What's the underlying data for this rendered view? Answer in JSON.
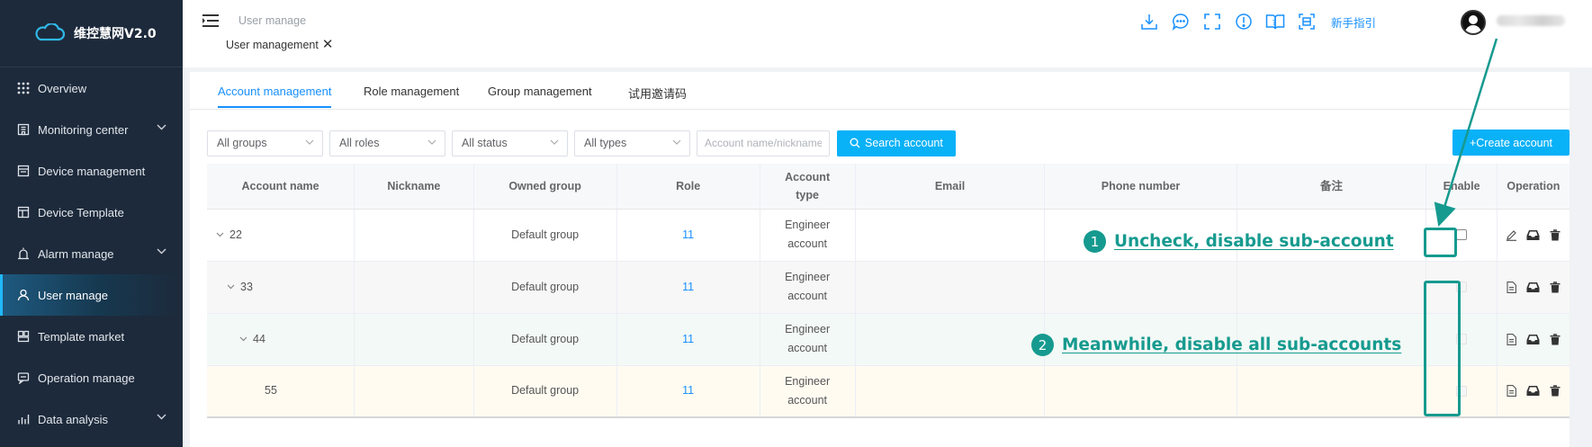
{
  "app": {
    "title": "维控慧网V2.0"
  },
  "sidebar": {
    "items": [
      {
        "label": "Overview",
        "icon": "grid-icon",
        "expandable": false,
        "active": false
      },
      {
        "label": "Monitoring center",
        "icon": "building-icon",
        "expandable": true,
        "active": false
      },
      {
        "label": "Device management",
        "icon": "device-icon",
        "expandable": false,
        "active": false
      },
      {
        "label": "Device Template",
        "icon": "template-icon",
        "expandable": false,
        "active": false
      },
      {
        "label": "Alarm manage",
        "icon": "alarm-icon",
        "expandable": true,
        "active": false
      },
      {
        "label": "User manage",
        "icon": "user-icon",
        "expandable": false,
        "active": true
      },
      {
        "label": "Template market",
        "icon": "market-icon",
        "expandable": false,
        "active": false
      },
      {
        "label": "Operation manage",
        "icon": "operation-icon",
        "expandable": false,
        "active": false
      },
      {
        "label": "Data analysis",
        "icon": "chart-icon",
        "expandable": true,
        "active": false
      }
    ]
  },
  "header": {
    "breadcrumb": "User manage",
    "open_tab": "User management",
    "guide_label": "新手指引",
    "icons": [
      "download-icon",
      "chat-icon",
      "fullscreen-icon",
      "info-icon",
      "help-book-icon",
      "scan-icon"
    ]
  },
  "tabs": [
    {
      "label": "Account management",
      "active": true
    },
    {
      "label": "Role management",
      "active": false
    },
    {
      "label": "Group management",
      "active": false
    },
    {
      "label": "试用邀请码",
      "active": false
    }
  ],
  "filters": {
    "group": "All groups",
    "role": "All roles",
    "status": "All status",
    "type": "All types",
    "search_placeholder": "Account name/nickname",
    "search_button": "Search account",
    "create_button": "+Create account"
  },
  "table": {
    "columns": {
      "account_name": "Account name",
      "nickname": "Nickname",
      "owned_group": "Owned group",
      "role": "Role",
      "account_type_1": "Account",
      "account_type_2": "type",
      "email": "Email",
      "phone": "Phone number",
      "remark": "备注",
      "enable": "Enable",
      "operation": "Operation"
    },
    "rows": [
      {
        "name": "22",
        "nickname": "",
        "group": "Default group",
        "role": "11",
        "type1": "Engineer",
        "type2": "account",
        "email": "",
        "phone": "",
        "remark": "",
        "enabled": false,
        "level": 0
      },
      {
        "name": "33",
        "nickname": "",
        "group": "Default group",
        "role": "11",
        "type1": "Engineer",
        "type2": "account",
        "email": "",
        "phone": "",
        "remark": "",
        "enabled": false,
        "level": 1
      },
      {
        "name": "44",
        "nickname": "",
        "group": "Default group",
        "role": "11",
        "type1": "Engineer",
        "type2": "account",
        "email": "",
        "phone": "",
        "remark": "",
        "enabled": false,
        "level": 2
      },
      {
        "name": "55",
        "nickname": "",
        "group": "Default group",
        "role": "11",
        "type1": "Engineer",
        "type2": "account",
        "email": "",
        "phone": "",
        "remark": "",
        "enabled": false,
        "level": 3
      }
    ]
  },
  "annotations": [
    {
      "number": "1",
      "text": "Uncheck, disable sub-account"
    },
    {
      "number": "2",
      "text": "Meanwhile, disable all sub-accounts"
    }
  ],
  "colors": {
    "primary": "#09b1f7",
    "link": "#1890ff",
    "annotation": "#169a8f",
    "sidebar": "#1d2a3b"
  }
}
